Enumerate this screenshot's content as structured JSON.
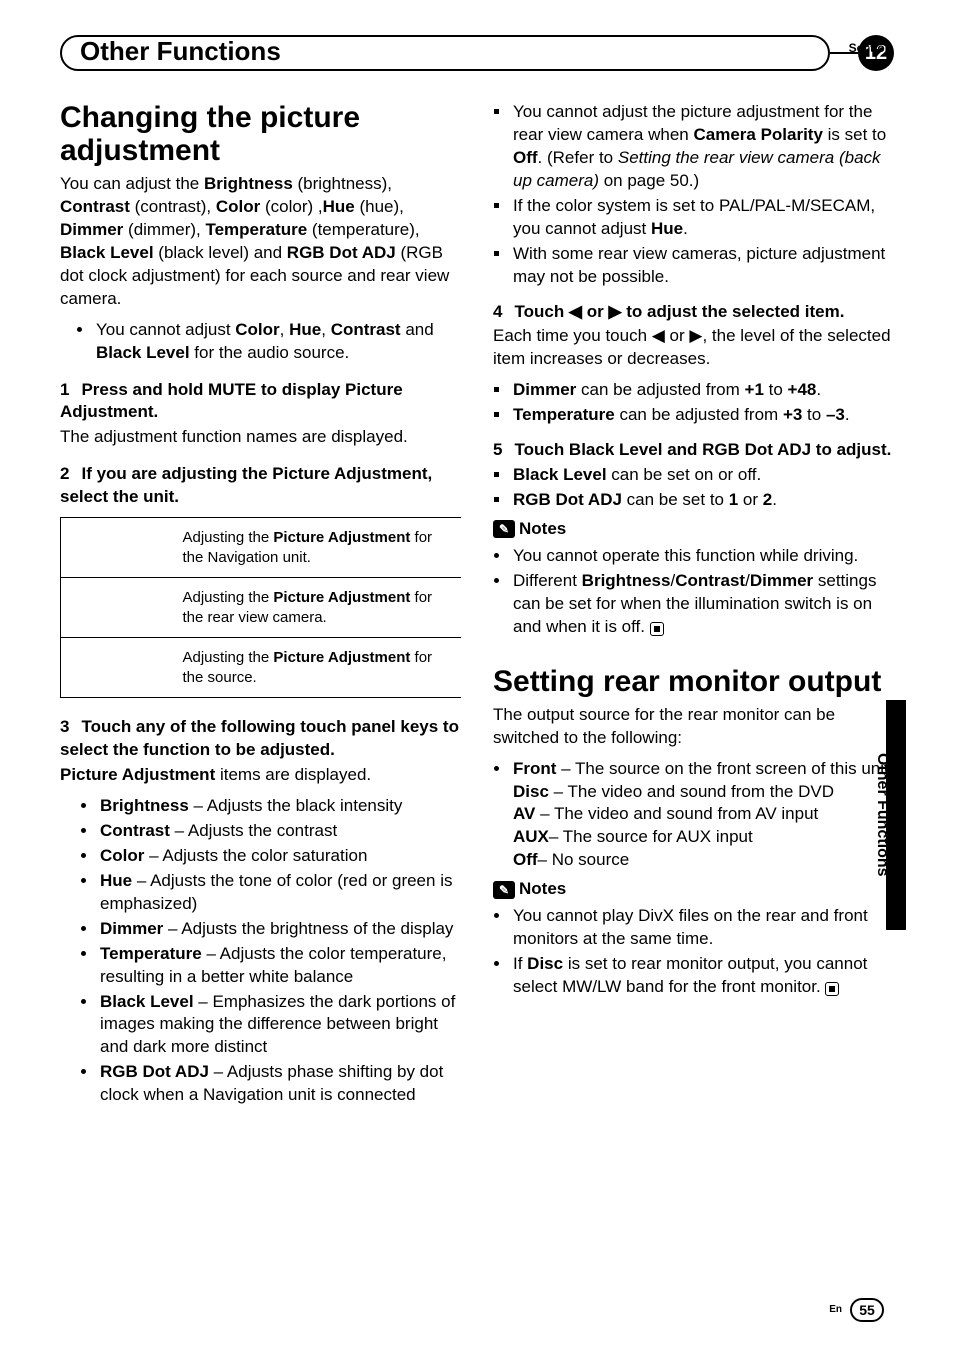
{
  "header": {
    "title": "Other Functions",
    "section_label": "Section",
    "section_number": "12"
  },
  "sidebar": {
    "label": "Other Functions"
  },
  "footer": {
    "lang": "En",
    "page": "55"
  },
  "left": {
    "h1": "Changing the picture adjustment",
    "intro_parts": [
      "You can adjust the ",
      "Brightness",
      " (brightness), ",
      "Contrast",
      " (contrast), ",
      "Color",
      " (color) ,",
      "Hue",
      " (hue), ",
      "Dimmer",
      " (dimmer), ",
      "Temperature",
      " (temperature), ",
      "Black Level",
      " (black level) and ",
      "RGB Dot ADJ",
      " (RGB dot clock adjustment) for each source and rear view camera."
    ],
    "intro_bullet": [
      "You cannot adjust ",
      "Color",
      ", ",
      "Hue",
      ", ",
      "Contrast",
      " and ",
      "Black Level",
      " for the audio source."
    ],
    "step1_head": [
      "1",
      "Press and hold MUTE to display Picture Adjustment."
    ],
    "step1_body": "The adjustment function names are displayed.",
    "step2_head": [
      "2",
      "If you are adjusting the Picture Adjustment, select the unit."
    ],
    "table": [
      [
        "Adjusting the ",
        "Picture Adjustment",
        " for the Navigation unit."
      ],
      [
        "Adjusting the ",
        "Picture Adjustment",
        " for the rear view camera."
      ],
      [
        "Adjusting the ",
        "Picture Adjustment",
        " for the source."
      ]
    ],
    "step3_head": [
      "3",
      "Touch any of the following touch panel keys to select the function to be adjusted."
    ],
    "step3_body": [
      "Picture Adjustment",
      " items are displayed."
    ],
    "step3_items": [
      [
        "Brightness",
        " – Adjusts the black intensity"
      ],
      [
        "Contrast",
        " – Adjusts the contrast"
      ],
      [
        "Color",
        " – Adjusts the color saturation"
      ],
      [
        "Hue",
        " – Adjusts the tone of color (red or green is emphasized)"
      ],
      [
        "Dimmer",
        " – Adjusts the brightness of the display"
      ],
      [
        "Temperature",
        " – Adjusts the color temperature, resulting in a better white balance"
      ],
      [
        "Black Level",
        " – Emphasizes the dark portions of images making the difference between bright and dark more distinct"
      ],
      [
        "RGB Dot ADJ",
        " – Adjusts phase shifting by dot clock when a Navigation unit is connected"
      ]
    ]
  },
  "right": {
    "cont_items": [
      [
        "You cannot adjust the picture adjustment for the rear view camera when ",
        "Camera Polarity",
        " is set to ",
        "Off",
        ". (Refer to ",
        "Setting the rear view camera (back up camera)",
        " on page 50.)"
      ],
      [
        "If the color system is set to PAL/PAL-M/SECAM, you cannot adjust ",
        "Hue",
        "."
      ],
      [
        "With some rear view cameras, picture adjustment may not be possible."
      ]
    ],
    "step4_head": [
      "4",
      "Touch ◀ or ▶ to adjust the selected item."
    ],
    "step4_body": [
      "Each time you touch ◀ or ▶, the level of the selected item increases or decreases."
    ],
    "step4_items": [
      [
        "Dimmer",
        " can be adjusted from ",
        "+1",
        " to ",
        "+48",
        "."
      ],
      [
        "Temperature",
        " can be adjusted from ",
        "+3",
        " to ",
        "–3",
        "."
      ]
    ],
    "step5_head": [
      "5",
      "Touch Black Level and RGB Dot ADJ to adjust."
    ],
    "step5_items": [
      [
        "Black Level",
        " can be set on or off."
      ],
      [
        "RGB Dot ADJ",
        " can be set to ",
        "1",
        " or ",
        "2",
        "."
      ]
    ],
    "notes1_label": "Notes",
    "notes1_items": [
      [
        "You cannot operate this function while driving."
      ],
      [
        "Different ",
        "Brightness",
        "/",
        "Contrast",
        "/",
        "Dimmer",
        " settings can be set for when the illumination switch is on and when it is off."
      ]
    ],
    "h2": "Setting rear monitor output",
    "rear_intro": "The output source for the rear monitor can be switched to the following:",
    "rear_item_lead": [
      "Front",
      " – The source on the front screen of this unit"
    ],
    "rear_sub": [
      [
        "Disc",
        " – The video and sound from the DVD"
      ],
      [
        "AV",
        " – The video and sound from AV input"
      ],
      [
        "AUX",
        "– The source for AUX input"
      ],
      [
        "Off",
        "– No source"
      ]
    ],
    "notes2_label": "Notes",
    "notes2_items": [
      [
        "You cannot play DivX files on the rear and front monitors at the same time."
      ],
      [
        "If ",
        "Disc",
        " is set to rear monitor output, you cannot select MW/LW band for the front monitor."
      ]
    ]
  }
}
